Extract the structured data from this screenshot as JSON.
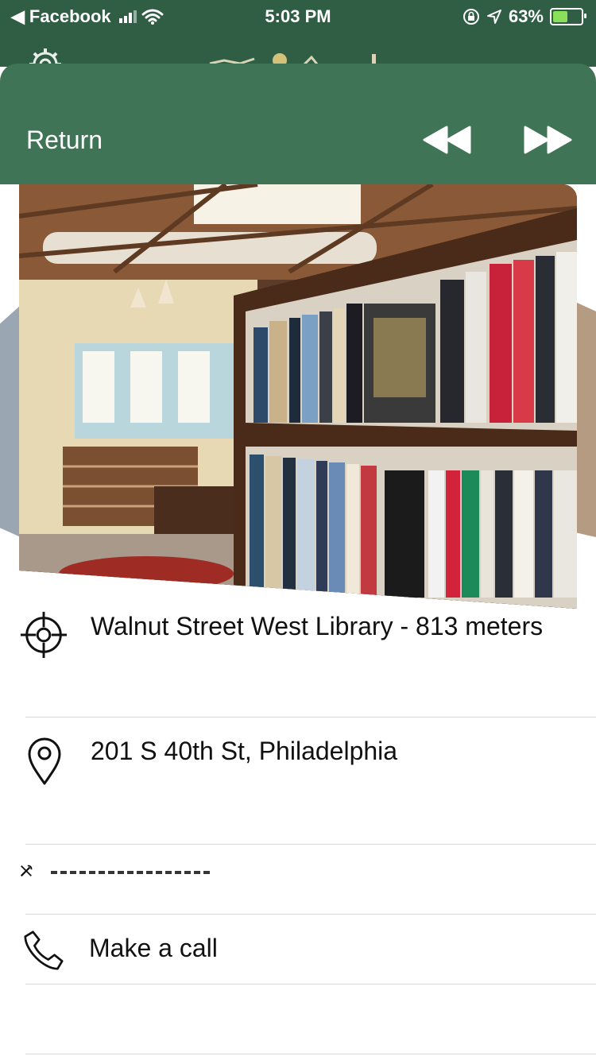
{
  "status_bar": {
    "back_app": "Facebook",
    "time": "5:03 PM",
    "battery_percent": "63%"
  },
  "header": {
    "return_label": "Return",
    "prev_icon": "rewind-icon",
    "next_icon": "fast-forward-icon"
  },
  "place": {
    "name_distance": "Walnut Street West Library - 813 meters",
    "address": "201 S 40th St, Philadelphia",
    "call_label": "Make a call"
  },
  "colors": {
    "header_green": "#3f7556",
    "status_green": "#2f5e44"
  }
}
